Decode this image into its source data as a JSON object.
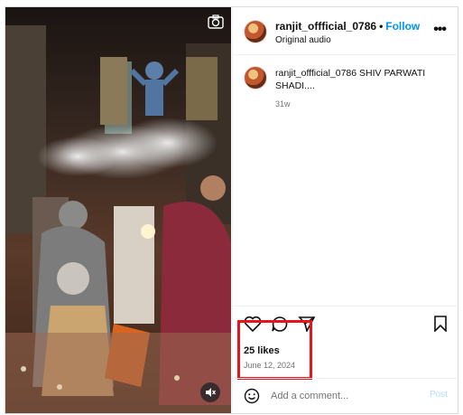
{
  "post": {
    "username": "ranjit_offficial_0786",
    "follow_label": "Follow",
    "separator": "•",
    "audio": "Original audio",
    "more": "•••"
  },
  "caption": {
    "username": "ranjit_offficial_0786",
    "text": "SHIV PARWATI SHADI....",
    "age": "31w"
  },
  "engagement": {
    "likes": "25 likes",
    "date": "June 12, 2024"
  },
  "comment": {
    "placeholder": "Add a comment...",
    "post_label": "Post"
  },
  "icons": {
    "media": [
      "camera-icon",
      "mute-icon"
    ],
    "actions": [
      "heart-icon",
      "comment-icon",
      "share-icon",
      "bookmark-icon"
    ],
    "comment": [
      "emoji-icon"
    ],
    "header": [
      "more-icon"
    ]
  },
  "colors": {
    "link": "#0095f6",
    "highlight": "#e8141b",
    "post_disabled": "#b3dbff",
    "muted_text": "#737373"
  }
}
